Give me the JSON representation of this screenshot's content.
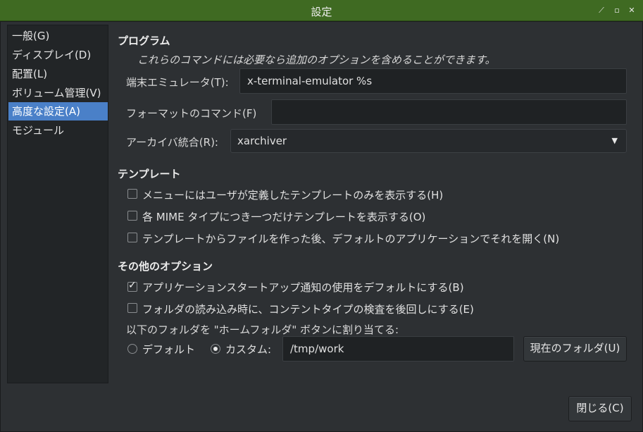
{
  "window": {
    "title": "設定"
  },
  "sidebar": {
    "items": [
      {
        "label": "一般(G)"
      },
      {
        "label": "ディスプレイ(D)"
      },
      {
        "label": "配置(L)"
      },
      {
        "label": "ボリューム管理(V)"
      },
      {
        "label": "高度な設定(A)",
        "selected": true
      },
      {
        "label": "モジュール"
      }
    ]
  },
  "programs": {
    "heading": "プログラム",
    "note": "これらのコマンドには必要なら追加のオプションを含めることができます。",
    "terminal_label": "端末エミュレータ(T):",
    "terminal_value": "x-terminal-emulator %s",
    "format_label": "フォーマットのコマンド(F)",
    "format_value": "",
    "archiver_label": "アーカイバ統合(R):",
    "archiver_value": "xarchiver"
  },
  "templates": {
    "heading": "テンプレート",
    "options": [
      {
        "label": "メニューにはユーザが定義したテンプレートのみを表示する(H)",
        "checked": false
      },
      {
        "label": "各 MIME タイプにつき一つだけテンプレートを表示する(O)",
        "checked": false
      },
      {
        "label": "テンプレートからファイルを作った後、デフォルトのアプリケーションでそれを開く(N)",
        "checked": false
      }
    ]
  },
  "other": {
    "heading": "その他のオプション",
    "options": [
      {
        "label": "アプリケーションスタートアップ通知の使用をデフォルトにする(B)",
        "checked": true
      },
      {
        "label": "フォルダの読み込み時に、コンテントタイプの検査を後回しにする(E)",
        "checked": false
      }
    ],
    "home_label": "以下のフォルダを \"ホームフォルダ\" ボタンに割り当てる:",
    "radio_default": "デフォルト",
    "radio_custom": "カスタム:",
    "custom_path": "/tmp/work",
    "current_folder_button": "現在のフォルダ(U)"
  },
  "footer": {
    "close_button": "閉じる(C)"
  }
}
